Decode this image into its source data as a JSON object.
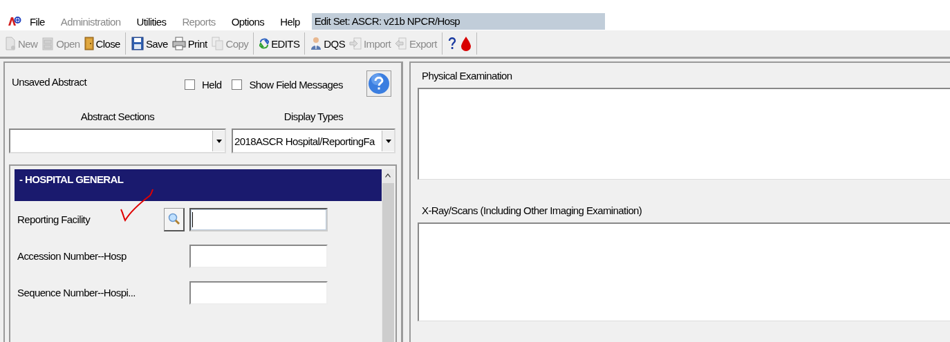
{
  "menu": [
    {
      "label": "File",
      "disabled": false
    },
    {
      "label": "Administration",
      "disabled": true
    },
    {
      "label": "Utilities",
      "disabled": false
    },
    {
      "label": "Reports",
      "disabled": true
    },
    {
      "label": "Options",
      "disabled": false
    },
    {
      "label": "Help",
      "disabled": false
    }
  ],
  "edit_set": "Edit Set: ASCR: v21b NPCR/Hosp",
  "toolbar": [
    {
      "items": [
        {
          "label": "New",
          "kind": "page",
          "disabled": true
        },
        {
          "label": "Open",
          "kind": "cabinet",
          "disabled": true
        },
        {
          "label": "Close",
          "kind": "door",
          "disabled": false
        }
      ]
    },
    {
      "items": [
        {
          "label": "Save",
          "kind": "floppy",
          "disabled": false
        },
        {
          "label": "Print",
          "kind": "printer",
          "disabled": false
        },
        {
          "label": "Copy",
          "kind": "copy",
          "disabled": true
        }
      ]
    },
    {
      "items": [
        {
          "label": "EDITS",
          "kind": "arrows",
          "disabled": false
        }
      ]
    },
    {
      "items": [
        {
          "label": "DQS",
          "kind": "person",
          "disabled": false
        },
        {
          "label": "Import",
          "kind": "import",
          "disabled": true
        },
        {
          "label": "Export",
          "kind": "export",
          "disabled": true
        }
      ]
    },
    {
      "items": [
        {
          "kind": "help",
          "disabled": false
        },
        {
          "kind": "drop",
          "disabled": false
        }
      ]
    }
  ],
  "abstract": {
    "status": "Unsaved Abstract",
    "checkboxes": [
      {
        "label": "Held",
        "checked": false
      },
      {
        "label": "Show Field Messages",
        "checked": false
      }
    ],
    "sections_label": "Abstract Sections",
    "display_label": "Display Types",
    "display_value": "2018ASCR Hospital/ReportingFa",
    "section_title": "- HOSPITAL GENERAL",
    "fields": [
      {
        "label": "Reporting Facility",
        "lookup": true,
        "focused": true
      },
      {
        "label": "Accession Number--Hosp",
        "lookup": false,
        "focused": false
      },
      {
        "label": "Sequence Number--Hospi...",
        "lookup": false,
        "focused": false
      }
    ]
  },
  "text_areas": [
    {
      "label": "Physical Examination"
    },
    {
      "label": "X-Ray/Scans (Including Other Imaging Examination)"
    }
  ]
}
